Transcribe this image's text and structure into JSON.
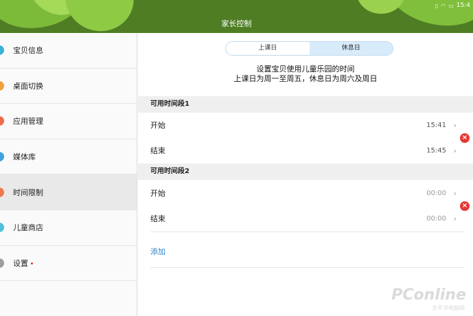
{
  "header": {
    "title": "家长控制",
    "status_time": "15:4",
    "colors": {
      "background": "#4f7d24",
      "leaf": "#7cba3a"
    }
  },
  "sidebar": {
    "items": [
      {
        "label": "宝贝信息",
        "dot_color": "#3bb0d9"
      },
      {
        "label": "桌面切换",
        "dot_color": "#f0a23a"
      },
      {
        "label": "应用管理",
        "dot_color": "#ef6c4a"
      },
      {
        "label": "媒体库",
        "dot_color": "#3fa3e0"
      },
      {
        "label": "时间限制",
        "dot_color": "#f0784f",
        "active": true
      },
      {
        "label": "儿童商店",
        "dot_color": "#4fc2d9"
      },
      {
        "label": "设置",
        "dot_color": "#9e9e9e",
        "badge": true
      }
    ]
  },
  "main": {
    "tabs": [
      {
        "label": "上课日",
        "selected": false
      },
      {
        "label": "休息日",
        "selected": true
      }
    ],
    "desc_line1": "设置宝贝使用儿童乐园的时间",
    "desc_line2": "上课日为周一至周五，休息日为周六及周日",
    "periods": [
      {
        "title": "可用时间段1",
        "start_label": "开始",
        "start_value": "15:41",
        "end_label": "结束",
        "end_value": "15:45"
      },
      {
        "title": "可用时间段2",
        "start_label": "开始",
        "start_value": "00:00",
        "end_label": "结束",
        "end_value": "00:00"
      }
    ],
    "add_label": "添加",
    "accent_color": "#2a84c7",
    "delete_color": "#e53935"
  },
  "watermark": {
    "text": "PConline",
    "sub": "太平洋电脑网"
  }
}
